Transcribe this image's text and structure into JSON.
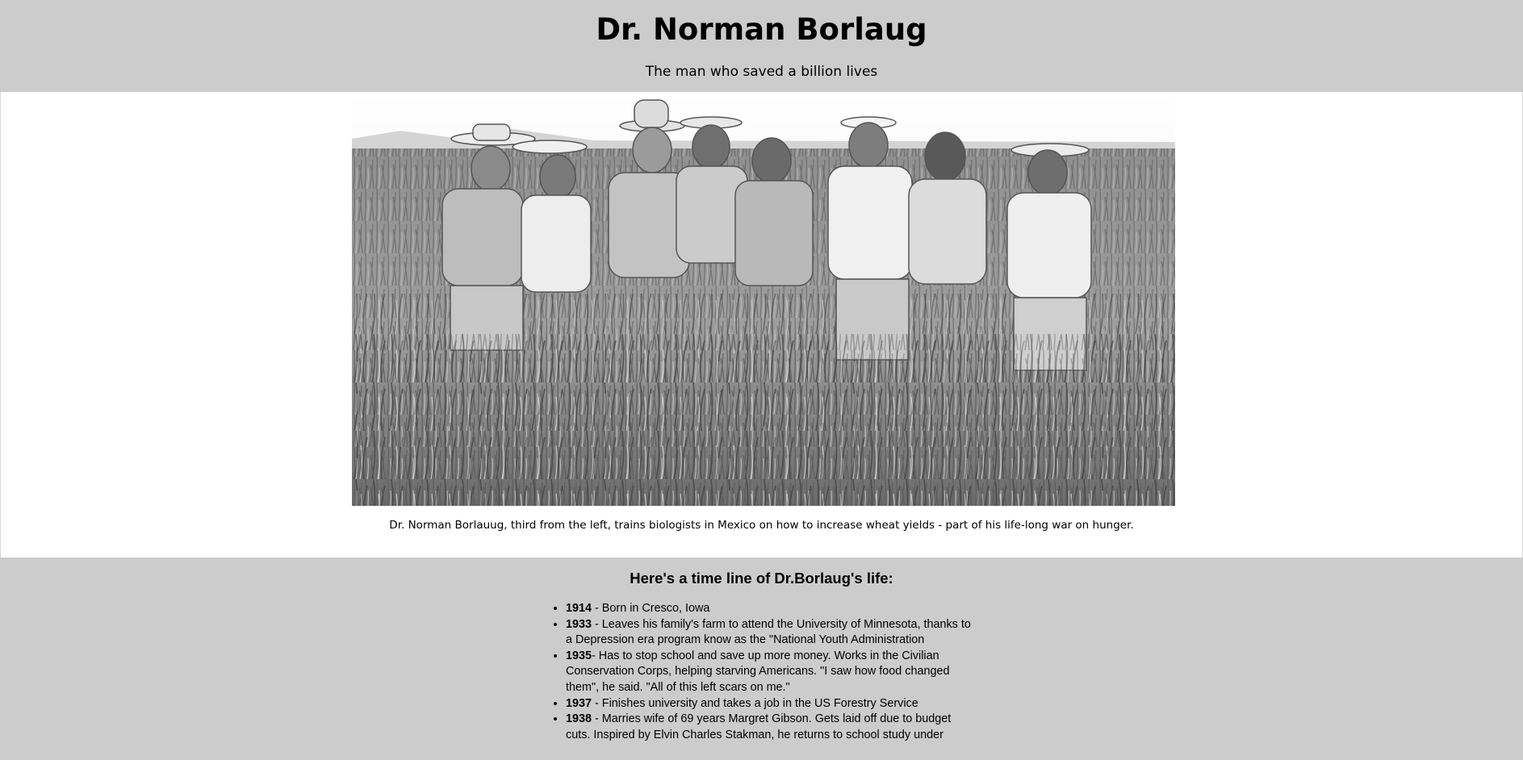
{
  "header": {
    "title": "Dr. Norman Borlaug",
    "subtitle": "The man who saved a billion lives"
  },
  "photo": {
    "alt": "Dr. Norman Borlaug with biologists in a wheat field",
    "caption": "Dr. Norman Borlauug, third from the left, trains biologists in Mexico on how to increase wheat yields - part of his life-long war on hunger."
  },
  "timeline": {
    "heading": "Here's a time line of Dr.Borlaug's life:",
    "items": [
      {
        "year": "1914",
        "text": " - Born in Cresco, Iowa"
      },
      {
        "year": "1933",
        "text": " - Leaves his family's farm to attend the University of Minnesota, thanks to a Depression era program know as the \"National Youth Administration"
      },
      {
        "year": "1935",
        "text": "- Has to stop school and save up more money. Works in the Civilian Conservation Corps, helping starving Americans. \"I saw how food changed them\", he said. \"All of this left scars on me.\""
      },
      {
        "year": "1937",
        "text": " - Finishes university and takes a job in the US Forestry Service"
      },
      {
        "year": "1938",
        "text": " - Marries wife of 69 years Margret Gibson. Gets laid off due to budget cuts. Inspired by Elvin Charles Stakman, he returns to school study under"
      }
    ]
  }
}
